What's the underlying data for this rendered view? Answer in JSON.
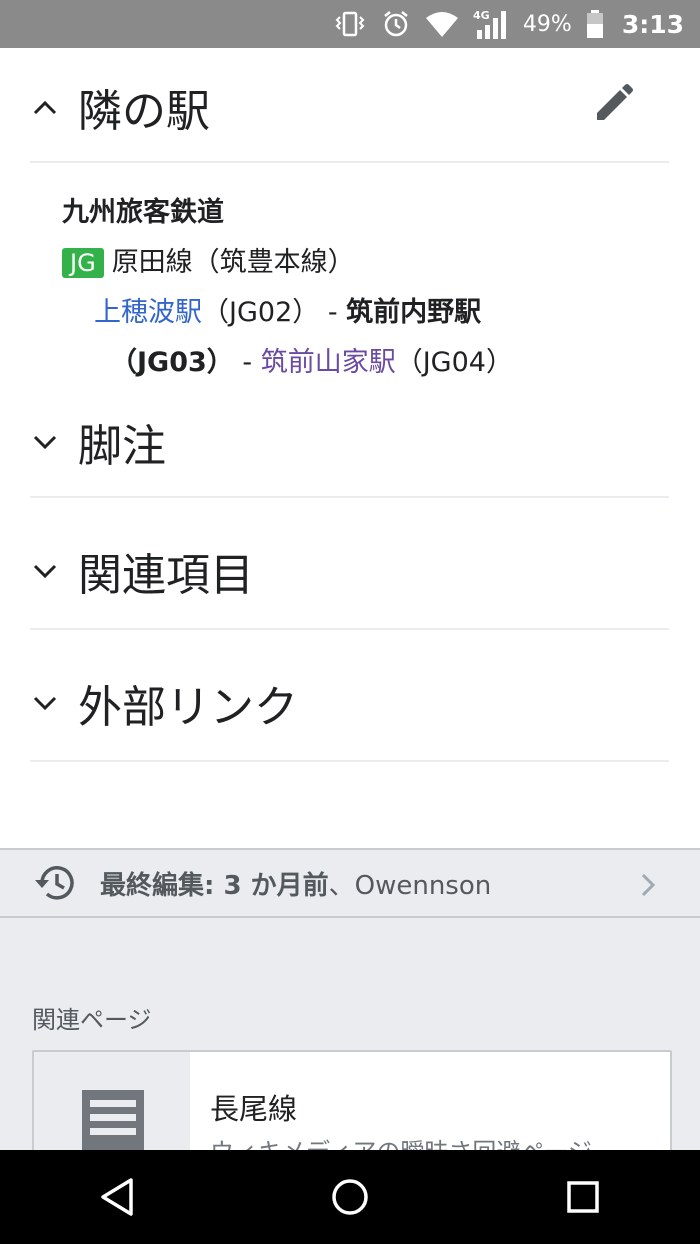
{
  "status_bar": {
    "network": "4G",
    "battery": "49%",
    "time": "3:13"
  },
  "sections": {
    "neighbor": {
      "title": "隣の駅",
      "expanded": true
    },
    "footnotes": {
      "title": "脚注",
      "expanded": false
    },
    "related": {
      "title": "関連項目",
      "expanded": false
    },
    "external": {
      "title": "外部リンク",
      "expanded": false
    }
  },
  "neighbor_content": {
    "operator": "九州旅客鉄道",
    "line_badge": "JG",
    "line_name": "原田線（筑豊本線）",
    "prev_station": "上穂波駅",
    "prev_code": "（JG02）",
    "sep1": " - ",
    "current_station": "筑前内野駅",
    "current_code": "（JG03）",
    "sep2": " - ",
    "next_station": "筑前山家駅",
    "next_code": "（JG04）"
  },
  "last_edit": {
    "label": "最終編集: 3 か月前",
    "separator": "、",
    "user": "Owennson"
  },
  "related_pages": {
    "heading": "関連ページ",
    "items": [
      {
        "title": "長尾線",
        "description": "ウィキメディアの曖昧さ回避ページ"
      }
    ]
  },
  "colors": {
    "badge_green": "#33b24a",
    "link": "#3366cc",
    "visited_link": "#6b4ba1"
  }
}
